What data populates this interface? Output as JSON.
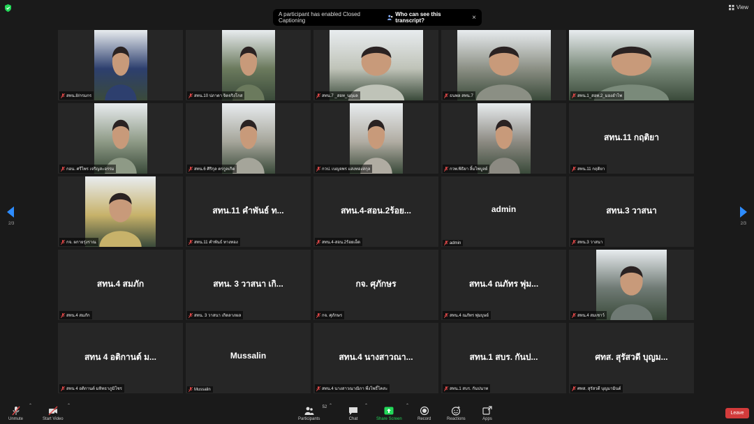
{
  "top": {
    "notice_text": "A participant has enabled Closed Captioning",
    "notice_link": "Who can see this transcript?",
    "close": "×",
    "view_label": "View"
  },
  "pager": {
    "left": "2/3",
    "right": "2/3"
  },
  "tiles": [
    {
      "label": "สทน.8/กรมกร",
      "video": true,
      "bg": "#2d3f6e"
    },
    {
      "label": "สทน.10 ปภาดา จิตจริงโกส",
      "video": true,
      "bg": "#6b7a5d"
    },
    {
      "label": "สทน.7 _สอท_นฤมล",
      "video": true,
      "bg": "#bfc3b8"
    },
    {
      "label": "ธนพล สทน.7",
      "video": true,
      "bg": "#8b8f84"
    },
    {
      "label": "สทน.1_สอท.2_มองอำไพ",
      "video": true,
      "bg": "#7a8a7a"
    },
    {
      "label": "กอน. ศรีไพร เจริญสะอรรม",
      "video": true,
      "bg": "#8e9a86"
    },
    {
      "label": "สทน.6 ศิริกุล ตรกูลเกิด",
      "video": true,
      "bg": "#a5a59a"
    },
    {
      "label": "กวป. เบญจพร แสงทองสกุล",
      "video": true,
      "bg": "#b0aca2"
    },
    {
      "label": "กวพ.พิธิยา ลิ้มไพบูลย์",
      "video": true,
      "bg": "#8c8a82"
    },
    {
      "label": "สทน.11 กฤติยา",
      "name": "สทน.11 กฤติยา",
      "video": false
    },
    {
      "label": "กจ. ผกายรุ่งราณ",
      "video": true,
      "bg": "#c7b26a"
    },
    {
      "label": "สทน.11 คำพันธ์ ทางทอง",
      "name": "สทน.11 คำพันธ์ ท...",
      "video": false
    },
    {
      "label": "สทน.4-สอน.2ร้อยเอ็ด",
      "name": "สทน.4-สอน.2ร้อย...",
      "video": false
    },
    {
      "label": "admin",
      "name": "admin",
      "video": false
    },
    {
      "label": "สทน.3 วาสนา",
      "name": "สทน.3 วาสนา",
      "video": false
    },
    {
      "label": "สทน.4 สมภัก",
      "name": "สทน.4 สมภัก",
      "video": false
    },
    {
      "label": "สทน. 3 วาสนา เกิดลาภผล",
      "name": "สทน. 3 วาสนา เกิ...",
      "video": false
    },
    {
      "label": "กจ. ศุภักษร",
      "name": "กจ. ศุภักษร",
      "video": false
    },
    {
      "label": "สทน.4 ณภัทร พุ่มบุษย์",
      "name": "สทน.4 ณภัทร พุ่ม...",
      "video": false
    },
    {
      "label": "สทน.4 สมเชาว์",
      "video": true,
      "bg": "#6f7a74"
    },
    {
      "label": "สทน 4 อติกานต์ มหิทธาภูมิโชร",
      "name": "สทน 4 อติกานต์ ม...",
      "video": false
    },
    {
      "label": "Mussalin",
      "name": "Mussalin",
      "video": false
    },
    {
      "label": "สทน.4 นางสาวณาณิกา พึ่งโพธิ์โคสะ",
      "name": "สทน.4 นางสาวณา...",
      "video": false
    },
    {
      "label": "สทน.1 สบร. กันปนาท",
      "name": "สทน.1 สบร. กันป...",
      "video": false
    },
    {
      "label": "ศทส. สุรัสวดี บุญมามินต์",
      "name": "ศทส. สุรัสวดี บุญม...",
      "video": false
    }
  ],
  "toolbar": {
    "unmute": "Unmute",
    "start_video": "Start Video",
    "participants": "Participants",
    "participants_count": "52",
    "chat": "Chat",
    "share": "Share Screen",
    "record": "Record",
    "reactions": "Reactions",
    "apps": "Apps",
    "leave": "Leave"
  },
  "colors": {
    "accent_green": "#23d959",
    "leave_red": "#d33b3b",
    "arrow_blue": "#2d8cff"
  }
}
